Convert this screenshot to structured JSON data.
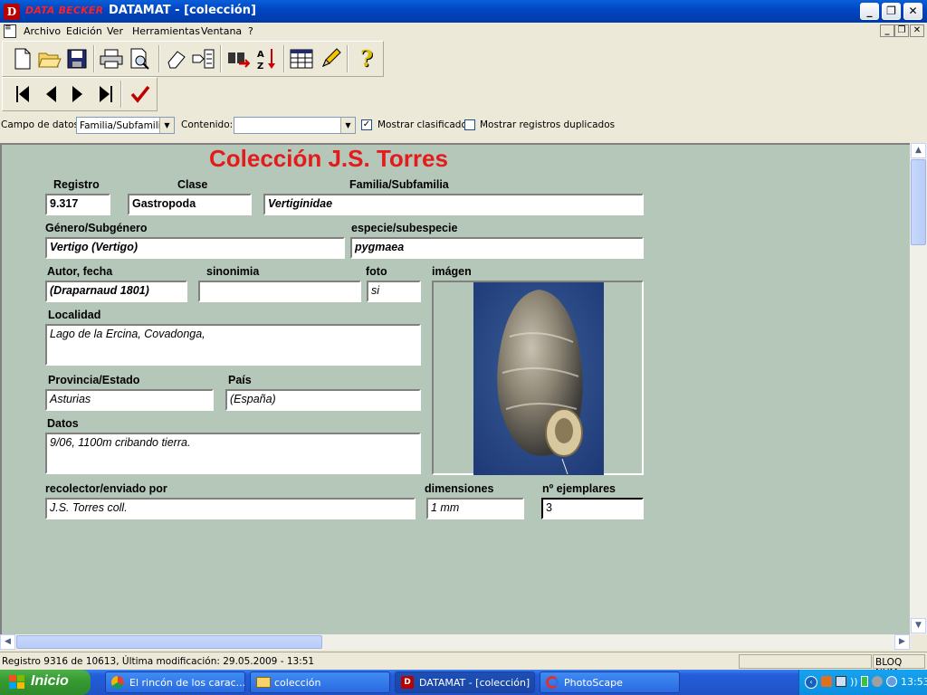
{
  "window": {
    "brand": "DATA BECKER",
    "title": "DATAMAT - [colección]"
  },
  "menu": [
    "Archivo",
    "Edición",
    "Ver",
    "Herramientas",
    "Ventana",
    "?"
  ],
  "filter": {
    "campo_label": "Campo de datos:",
    "campo_value": "Familia/Subfamilia",
    "contenido_label": "Contenido:",
    "contenido_value": "",
    "mostrar_clasificado": "Mostrar clasificado",
    "mostrar_clasificado_checked": true,
    "mostrar_duplicados": "Mostrar registros duplicados",
    "mostrar_duplicados_checked": false
  },
  "form": {
    "title": "Colección J.S. Torres",
    "registro": {
      "label": "Registro",
      "value": "9.317"
    },
    "clase": {
      "label": "Clase",
      "value": "Gastropoda"
    },
    "familia": {
      "label": "Familia/Subfamilia",
      "value": "Vertiginidae"
    },
    "genero": {
      "label": "Género/Subgénero",
      "value": "Vertigo (Vertigo)"
    },
    "especie": {
      "label": "especie/subespecie",
      "value": "pygmaea"
    },
    "autor": {
      "label": "Autor, fecha",
      "value": "(Draparnaud 1801)"
    },
    "sinonimia": {
      "label": "sinonimia",
      "value": ""
    },
    "foto": {
      "label": "foto",
      "value": "si"
    },
    "imagen": {
      "label": "imágen"
    },
    "localidad": {
      "label": "Localidad",
      "value": "Lago de la Ercina, Covadonga,"
    },
    "provincia": {
      "label": "Provincia/Estado",
      "value": "Asturias"
    },
    "pais": {
      "label": "País",
      "value": "(España)"
    },
    "datos": {
      "label": "Datos",
      "value": "9/06, 1100m cribando tierra."
    },
    "recolector": {
      "label": "recolector/enviado por",
      "value": "J.S. Torres coll."
    },
    "dimensiones": {
      "label": "dimensiones",
      "value": "1 mm"
    },
    "ejemplares": {
      "label": "nº ejemplares",
      "value": "3"
    }
  },
  "status": {
    "text": "Registro 9316 de 10613, Última modificación: 29.05.2009 - 13:51",
    "bloq": "BLOQ NUM"
  },
  "taskbar": {
    "start": "Inicio",
    "tasks": [
      "El rincón de los carac...",
      "colección",
      "DATAMAT - [colección]",
      "PhotoScape"
    ],
    "clock": "13:53"
  }
}
